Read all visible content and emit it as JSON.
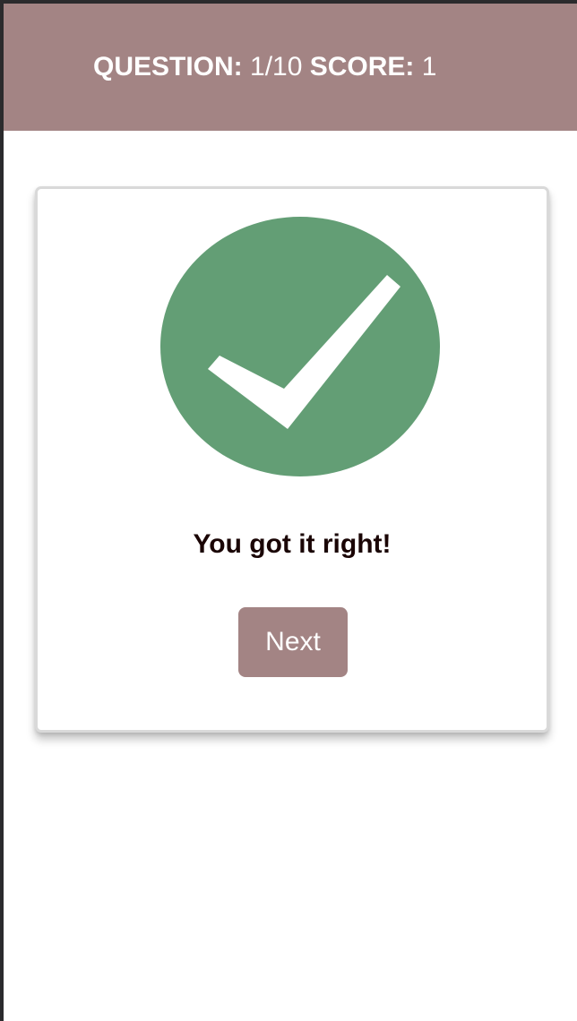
{
  "header": {
    "question_label": "QUESTION:",
    "question_value": "1/10",
    "score_label": "SCORE:",
    "score_value": "1"
  },
  "result": {
    "icon": "checkmark-circle-icon",
    "message": "You got it right!",
    "next_label": "Next"
  },
  "colors": {
    "header_bg": "#a38484",
    "check_green": "#639e75",
    "button_bg": "#a38484",
    "message_text": "#1a0505"
  }
}
